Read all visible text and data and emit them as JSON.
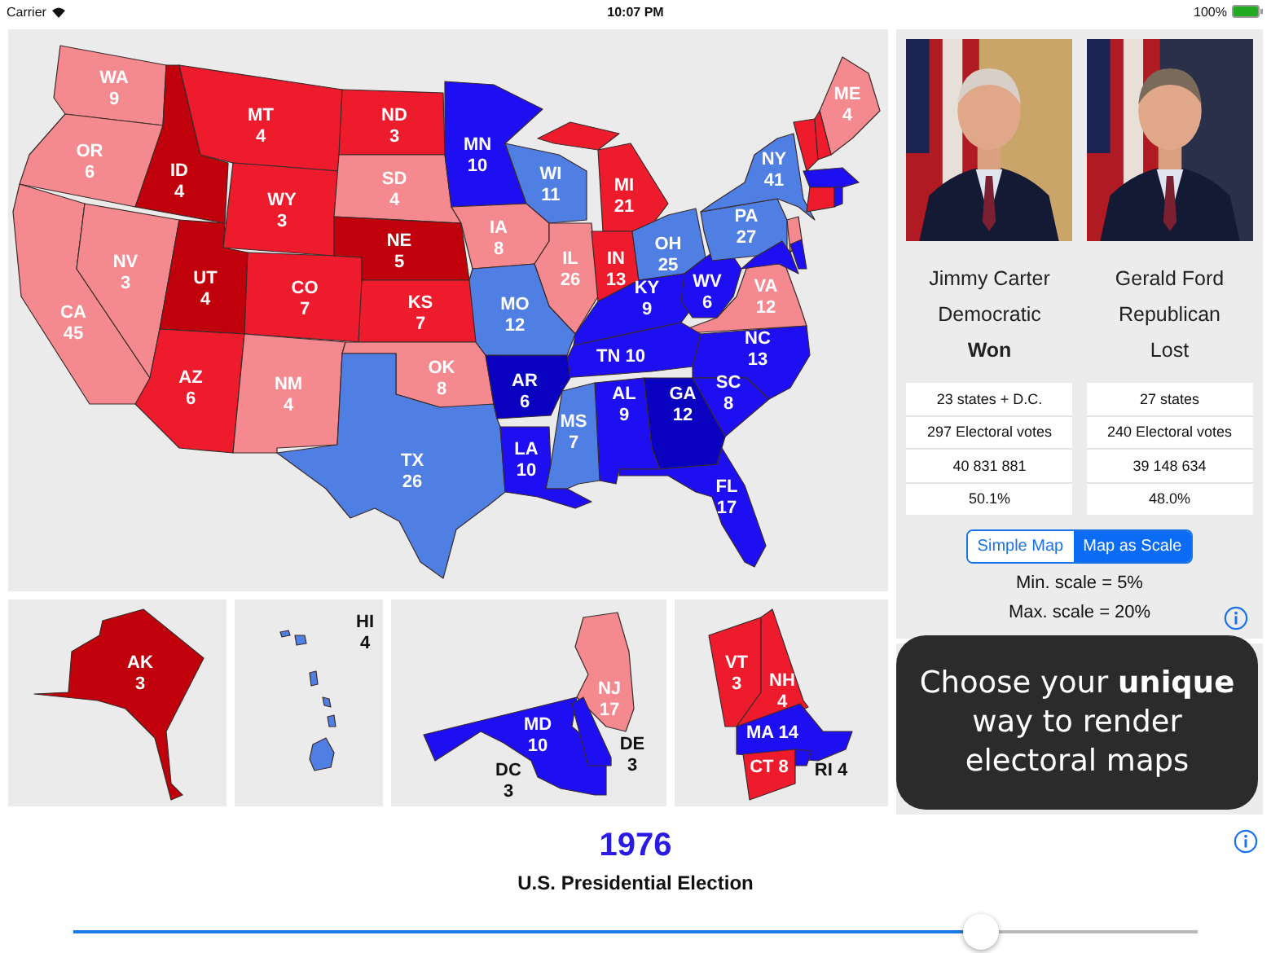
{
  "status_bar": {
    "carrier": "Carrier",
    "time": "10:07 PM",
    "battery": "100%"
  },
  "map": {
    "states": [
      {
        "abbr": "WA",
        "votes": "9",
        "color": "#f48a8f"
      },
      {
        "abbr": "OR",
        "votes": "6",
        "color": "#f48a8f"
      },
      {
        "abbr": "CA",
        "votes": "45",
        "color": "#f48a8f"
      },
      {
        "abbr": "NV",
        "votes": "3",
        "color": "#f48a8f"
      },
      {
        "abbr": "ID",
        "votes": "4",
        "color": "#c0000b"
      },
      {
        "abbr": "MT",
        "votes": "4",
        "color": "#ee1b2d"
      },
      {
        "abbr": "WY",
        "votes": "3",
        "color": "#ee1b2d"
      },
      {
        "abbr": "UT",
        "votes": "4",
        "color": "#c0000b"
      },
      {
        "abbr": "CO",
        "votes": "7",
        "color": "#ee1b2d"
      },
      {
        "abbr": "AZ",
        "votes": "6",
        "color": "#ee1b2d"
      },
      {
        "abbr": "NM",
        "votes": "4",
        "color": "#f48a8f"
      },
      {
        "abbr": "ND",
        "votes": "3",
        "color": "#ee1b2d"
      },
      {
        "abbr": "SD",
        "votes": "4",
        "color": "#f48a8f"
      },
      {
        "abbr": "NE",
        "votes": "5",
        "color": "#c0000b"
      },
      {
        "abbr": "KS",
        "votes": "7",
        "color": "#ee1b2d"
      },
      {
        "abbr": "OK",
        "votes": "8",
        "color": "#f48a8f"
      },
      {
        "abbr": "TX",
        "votes": "26",
        "color": "#4f7fe3"
      },
      {
        "abbr": "MN",
        "votes": "10",
        "color": "#1e0ff2"
      },
      {
        "abbr": "WI",
        "votes": "11",
        "color": "#4f7fe3"
      },
      {
        "abbr": "MI",
        "votes": "21",
        "color": "#ee1b2d"
      },
      {
        "abbr": "IA",
        "votes": "8",
        "color": "#f48a8f"
      },
      {
        "abbr": "IL",
        "votes": "26",
        "color": "#f48a8f"
      },
      {
        "abbr": "IN",
        "votes": "13",
        "color": "#ee1b2d"
      },
      {
        "abbr": "OH",
        "votes": "25",
        "color": "#4f7fe3"
      },
      {
        "abbr": "KY",
        "votes": "9",
        "color": "#1e0ff2"
      },
      {
        "abbr": "WV",
        "votes": "6",
        "color": "#1e0ff2"
      },
      {
        "abbr": "VA",
        "votes": "12",
        "color": "#f48a8f"
      },
      {
        "abbr": "TN",
        "votes": "10",
        "color": "#1e0ff2"
      },
      {
        "abbr": "NC",
        "votes": "13",
        "color": "#1e0ff2"
      },
      {
        "abbr": "SC",
        "votes": "8",
        "color": "#1e0ff2"
      },
      {
        "abbr": "GA",
        "votes": "12",
        "color": "#0a00c0"
      },
      {
        "abbr": "AL",
        "votes": "9",
        "color": "#1e0ff2"
      },
      {
        "abbr": "MS",
        "votes": "7",
        "color": "#4f7fe3"
      },
      {
        "abbr": "AR",
        "votes": "6",
        "color": "#0a00c0"
      },
      {
        "abbr": "LA",
        "votes": "10",
        "color": "#1e0ff2"
      },
      {
        "abbr": "MO",
        "votes": "12",
        "color": "#4f7fe3"
      },
      {
        "abbr": "FL",
        "votes": "17",
        "color": "#1e0ff2"
      },
      {
        "abbr": "PA",
        "votes": "27",
        "color": "#4f7fe3"
      },
      {
        "abbr": "NY",
        "votes": "41",
        "color": "#4f7fe3"
      },
      {
        "abbr": "ME",
        "votes": "4",
        "color": "#f48a8f"
      },
      {
        "color": "#f48a8f"
      },
      {
        "color": "#1e0ff2"
      },
      {
        "color": "#1e0ff2"
      },
      {
        "color": "#ee1b2d"
      },
      {
        "color": "#ee1b2d"
      },
      {
        "color": "#1e0ff2"
      },
      {
        "color": "#ee1b2d"
      },
      {
        "color": "#1e0ff2"
      }
    ]
  },
  "insets": [
    {
      "states": [
        {
          "abbr": "AK",
          "votes": "3",
          "color": "#c0000b"
        }
      ]
    },
    {
      "states": [
        {
          "abbr": "HI",
          "votes": "4",
          "color": "#4f7fe3"
        }
      ]
    },
    {
      "states": [
        {
          "abbr": "NJ",
          "votes": "17",
          "color": "#f48a8f"
        },
        {
          "abbr": "MD",
          "votes": "10",
          "color": "#1e0ff2"
        },
        {
          "abbr": "DE",
          "votes": "3",
          "color": "#1e0ff2"
        },
        {
          "abbr": "DC",
          "votes": "3"
        }
      ]
    },
    {
      "states": [
        {
          "abbr": "VT",
          "votes": "3",
          "color": "#ee1b2d"
        },
        {
          "abbr": "NH",
          "votes": "4",
          "color": "#ee1b2d"
        },
        {
          "abbr": "MA",
          "votes": "14",
          "color": "#1e0ff2"
        },
        {
          "abbr": "CT",
          "votes": "8",
          "color": "#ee1b2d"
        },
        {
          "abbr": "RI",
          "votes": "4",
          "color": "#1e0ff2"
        }
      ]
    }
  ],
  "candidates": [
    {
      "name": "Jimmy Carter",
      "party": "Democratic",
      "result": "Won",
      "won": true,
      "stats": [
        "23 states + D.C.",
        "297 Electoral votes",
        "40 831 881",
        "50.1%"
      ]
    },
    {
      "name": "Gerald Ford",
      "party": "Republican",
      "result": "Lost",
      "won": false,
      "stats": [
        "27 states",
        "240 Electoral votes",
        "39 148 634",
        "48.0%"
      ]
    }
  ],
  "scale_control": {
    "segments": [
      {
        "label": "Simple Map",
        "selected": false
      },
      {
        "label": "Map as Scale",
        "selected": true
      }
    ]
  },
  "min_scale": "Min. scale = 5%",
  "max_scale": "Max. scale = 20%",
  "tip": [
    "Choose your **unique**",
    "way to render",
    "electoral maps"
  ],
  "election": {
    "year": "1976",
    "title": "U.S. Presidential Election",
    "slider": {
      "level": 0.807
    }
  }
}
